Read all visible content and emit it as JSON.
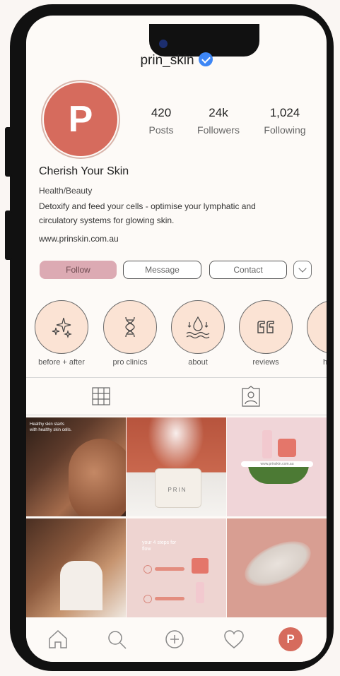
{
  "profile": {
    "handle": "prin_skin",
    "avatar_letter": "P",
    "stats": [
      {
        "value": "420",
        "label": "Posts"
      },
      {
        "value": "24k",
        "label": "Followers"
      },
      {
        "value": "1,024",
        "label": "Following"
      }
    ],
    "name": "Cherish Your Skin",
    "category": "Health/Beauty",
    "bio": "Detoxify and feed your cells - optimise your lymphatic and circulatory systems for glowing skin.",
    "website": "www.prinskin.com.au"
  },
  "actions": {
    "follow": "Follow",
    "message": "Message",
    "contact": "Contact"
  },
  "highlights": [
    {
      "label": "before + after",
      "icon": "sparkles-icon"
    },
    {
      "label": "pro clinics",
      "icon": "dna-icon"
    },
    {
      "label": "about",
      "icon": "water-drop-icon"
    },
    {
      "label": "reviews",
      "icon": "quote-icon"
    },
    {
      "label": "h",
      "icon": "highlight-icon"
    }
  ],
  "tabs": [
    {
      "name": "grid",
      "icon": "grid-icon"
    },
    {
      "name": "tagged",
      "icon": "tagged-person-icon"
    }
  ],
  "posts": [
    {
      "overlay_text": "Healthy skin starts with healthy skin cells."
    },
    {
      "overlay_text": "PRIN"
    },
    {
      "overlay_text": "www.prinskin.com.au"
    },
    {
      "overlay_text": ""
    },
    {
      "overlay_text": "your 4 steps for flow"
    },
    {
      "overlay_text": ""
    }
  ],
  "nav": {
    "avatar_letter": "P",
    "icons": [
      "home-icon",
      "search-icon",
      "add-post-icon",
      "activity-heart-icon",
      "profile-avatar"
    ]
  },
  "colors": {
    "brand": "#d66b5d",
    "follow_button": "#dcaab3",
    "highlight_fill": "#fbe3d4",
    "verified": "#3d86f5"
  }
}
